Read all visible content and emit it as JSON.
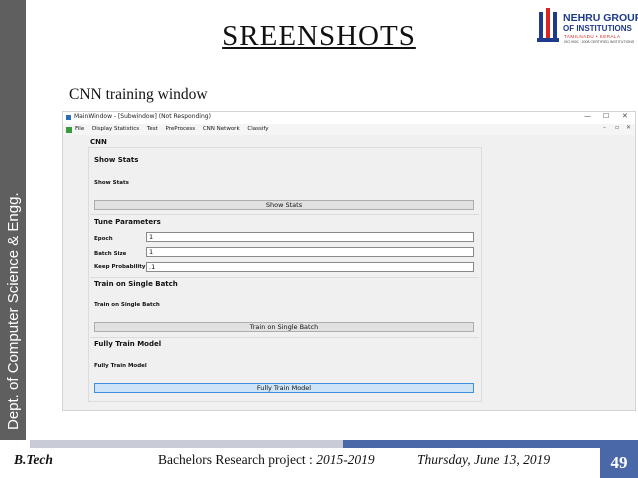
{
  "slide": {
    "sidebar_text": "Dept. of Computer Science & Engg.",
    "title": "SREENSHOTS",
    "caption": "CNN training window",
    "logo": {
      "line1": "NEHRU GROUP",
      "line2": "OF INSTITUTIONS",
      "line3": "TAMILNADU • KERALA",
      "line4": "ISO 9001 : 2008 CERTIFIED INSTITUTIONS"
    },
    "footer": {
      "left": "B.Tech",
      "center_prefix": "Bachelors  Research project : ",
      "center_years": "2015-2019",
      "right": "Thursday, June 13, 2019",
      "page": "49"
    }
  },
  "window": {
    "title": "MainWindow - [Subwindow] (Not Responding)",
    "controls": {
      "minimize": "—",
      "maximize": "☐",
      "close": "✕"
    },
    "menu": [
      "File",
      "Display Statistics",
      "Test",
      "PreProcess",
      "CNN Network",
      "Classify"
    ],
    "mdi_controls": [
      "–",
      "▫",
      "✕"
    ]
  },
  "cnn_panel": {
    "title": "CNN",
    "show_stats": {
      "section": "Show Stats",
      "label": "Show Stats",
      "button": "Show Stats"
    },
    "tune_parameters": {
      "section": "Tune Parameters",
      "epoch_label": "Epoch",
      "epoch_value": "1",
      "batch_size_label": "Batch Size",
      "batch_size_value": "1",
      "keep_prob_label": "Keep Probability",
      "keep_prob_value": ".1"
    },
    "single_batch": {
      "section": "Train on Single Batch",
      "label": "Train on Single Batch",
      "button": "Train on Single Batch"
    },
    "fully_train": {
      "section": "Fully Train Model",
      "label": "Fully Train Model",
      "button": "Fully Train Model"
    }
  },
  "colors": {
    "sidebar": "#5f5f5f",
    "footer_dark": "#4a68a8",
    "footer_light": "#c9ccd6",
    "active_button": "#cde4f7"
  }
}
